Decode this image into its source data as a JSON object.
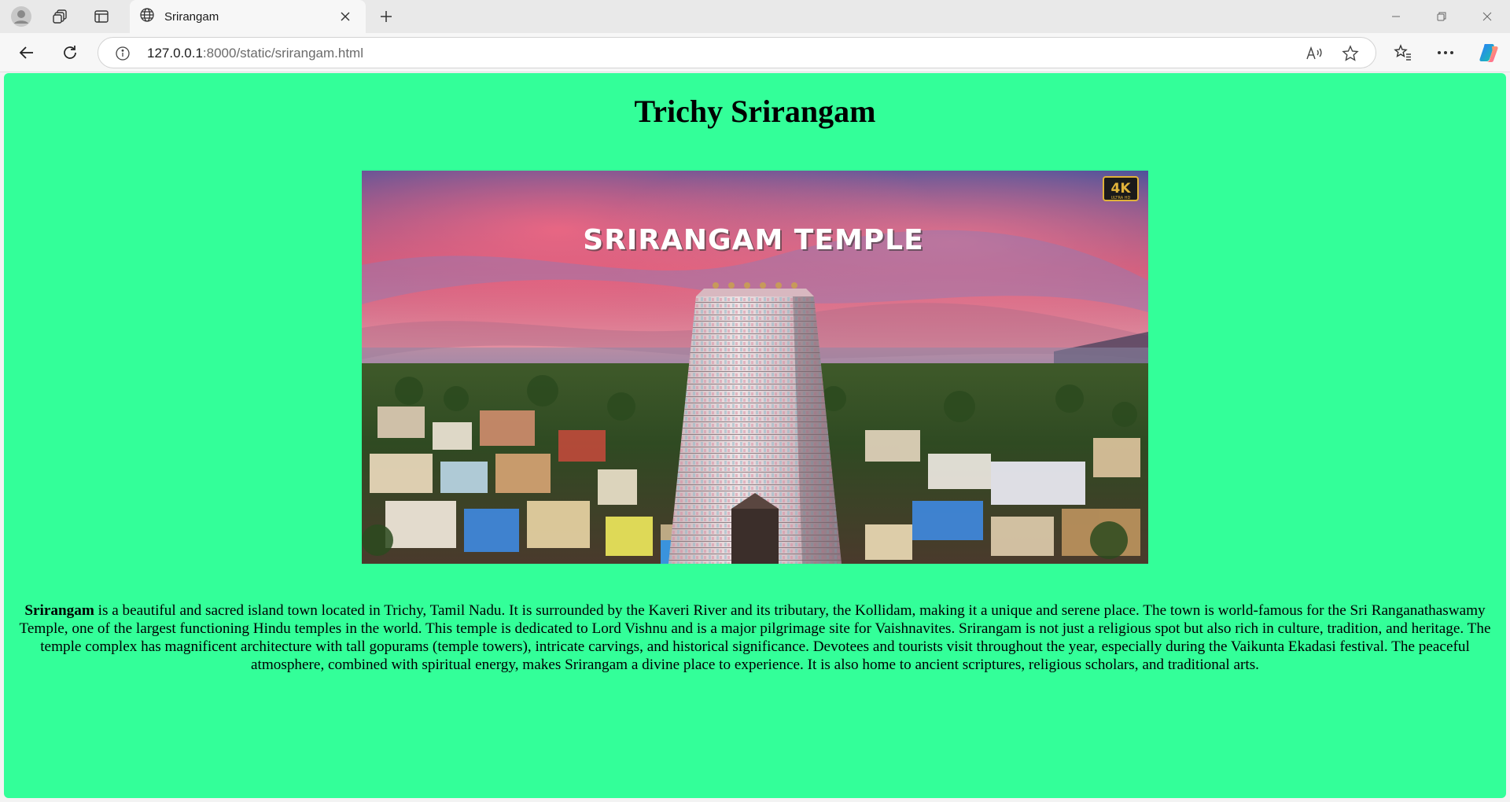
{
  "browser": {
    "tab_title": "Srirangam",
    "url_host": "127.0.0.1",
    "url_path": ":8000/static/srirangam.html"
  },
  "page": {
    "heading": "Trichy Srirangam",
    "image": {
      "overlay_title": "SRIRANGAM TEMPLE",
      "badge_main": "4K",
      "badge_sub": "ULTRA HD"
    },
    "description_bold": "Srirangam",
    "description_rest": " is a beautiful and sacred island town located in Trichy, Tamil Nadu. It is surrounded by the Kaveri River and its tributary, the Kollidam, making it a unique and serene place. The town is world-famous for the Sri Ranganathaswamy Temple, one of the largest functioning Hindu temples in the world. This temple is dedicated to Lord Vishnu and is a major pilgrimage site for Vaishnavites. Srirangam is not just a religious spot but also rich in culture, tradition, and heritage. The temple complex has magnificent architecture with tall gopurams (temple towers), intricate carvings, and historical significance. Devotees and tourists visit throughout the year, especially during the Vaikunta Ekadasi festival. The peaceful atmosphere, combined with spiritual energy, makes Srirangam a divine place to experience. It is also home to ancient scriptures, religious scholars, and traditional arts."
  },
  "colors": {
    "page_background": "#33ff99",
    "tabstrip": "#e9e9e9"
  }
}
